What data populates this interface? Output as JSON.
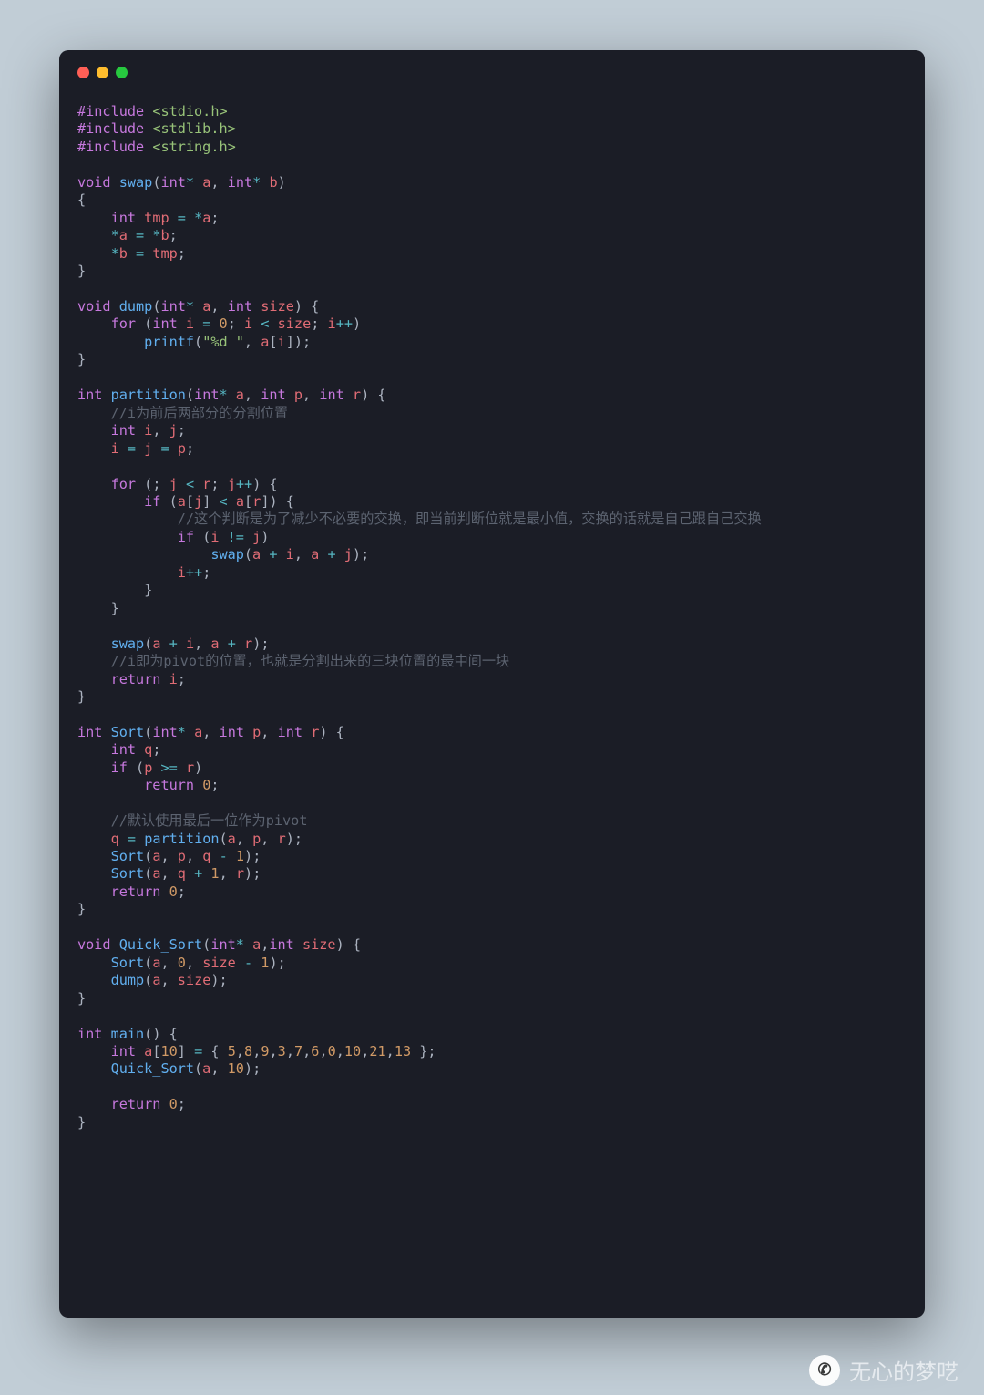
{
  "window": {
    "dots": [
      "close",
      "minimize",
      "zoom"
    ]
  },
  "code": "#include <stdio.h>\n#include <stdlib.h>\n#include <string.h>\n\nvoid swap(int* a, int* b)\n{\n    int tmp = *a;\n    *a = *b;\n    *b = tmp;\n}\n\nvoid dump(int* a, int size) {\n    for (int i = 0; i < size; i++)\n        printf(\"%d \", a[i]);\n}\n\nint partition(int* a, int p, int r) {\n    //i为前后两部分的分割位置\n    int i, j;\n    i = j = p;\n\n    for (; j < r; j++) {\n        if (a[j] < a[r]) {\n            //这个判断是为了减少不必要的交换，即当前判断位就是最小值，交换的话就是自己跟自己交换\n            if (i != j)\n                swap(a + i, a + j);\n            i++;\n        }\n    }\n\n    swap(a + i, a + r);\n    //i即为pivot的位置，也就是分割出来的三块位置的最中间一块\n    return i;\n}\n\nint Sort(int* a, int p, int r) {\n    int q;\n    if (p >= r)\n        return 0;\n\n    //默认使用最后一位作为pivot\n    q = partition(a, p, r);\n    Sort(a, p, q - 1);\n    Sort(a, q + 1, r);\n    return 0;\n}\n\nvoid Quick_Sort(int* a,int size) {\n    Sort(a, 0, size - 1);\n    dump(a, size);\n}\n\nint main() {\n    int a[10] = { 5,8,9,3,7,6,0,10,21,13 };\n    Quick_Sort(a, 10);\n\n    return 0;\n}",
  "watermark": {
    "text": "无心的梦呓",
    "icon": "✆"
  }
}
